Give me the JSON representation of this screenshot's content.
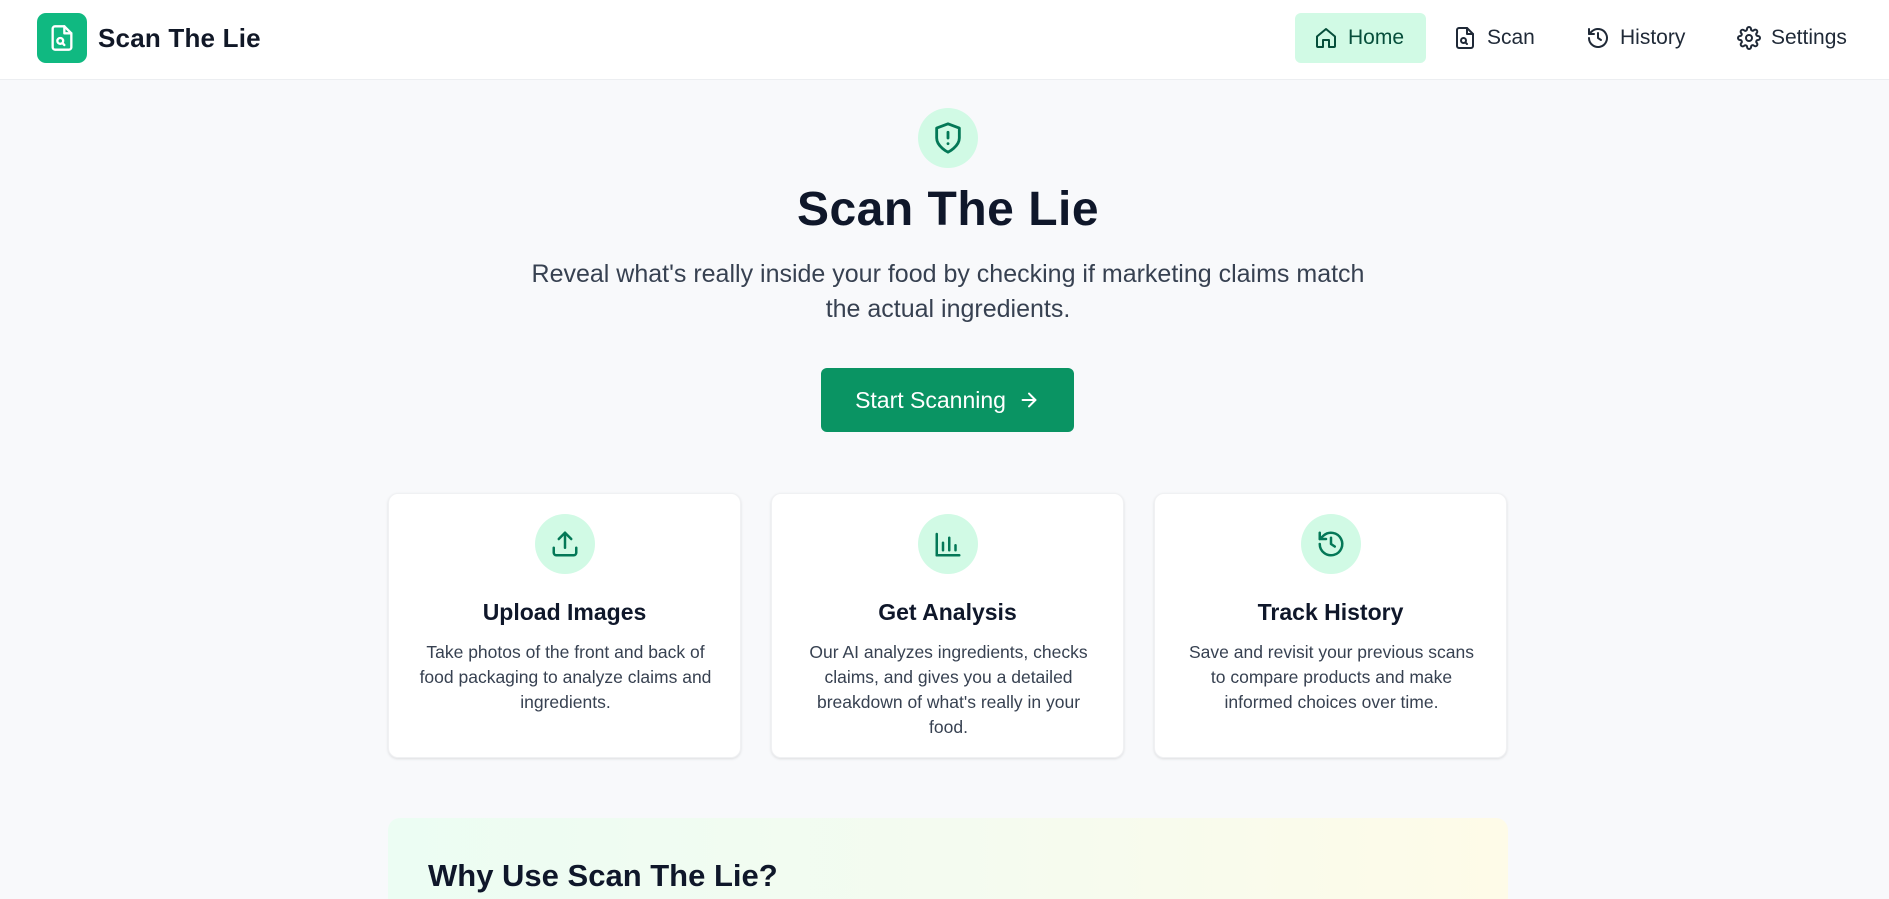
{
  "brand": {
    "name": "Scan The Lie",
    "icon": "file-search-icon"
  },
  "nav": {
    "items": [
      {
        "label": "Home",
        "icon": "home-icon",
        "active": true
      },
      {
        "label": "Scan",
        "icon": "file-scan-icon",
        "active": false
      },
      {
        "label": "History",
        "icon": "history-icon",
        "active": false
      },
      {
        "label": "Settings",
        "icon": "gear-icon",
        "active": false
      }
    ]
  },
  "hero": {
    "icon": "shield-alert-icon",
    "title": "Scan The Lie",
    "subtitle": "Reveal what's really inside your food by checking if marketing claims match the actual ingredients.",
    "cta_label": "Start Scanning",
    "cta_icon": "arrow-right-icon"
  },
  "features": [
    {
      "icon": "upload-icon",
      "title": "Upload Images",
      "description": "Take photos of the front and back of food packaging to analyze claims and ingredients."
    },
    {
      "icon": "bar-chart-icon",
      "title": "Get Analysis",
      "description": "Our AI analyzes ingredients, checks claims, and gives you a detailed breakdown of what's really in your food."
    },
    {
      "icon": "history-icon",
      "title": "Track History",
      "description": "Save and revisit your previous scans to compare products and make informed choices over time."
    }
  ],
  "why": {
    "title": "Why Use Scan The Lie?"
  },
  "colors": {
    "accent": "#10b981",
    "button": "#0a9463",
    "icon_bg": "#d1fae5",
    "icon_stroke": "#047857",
    "page_bg": "#f8f9fb"
  }
}
